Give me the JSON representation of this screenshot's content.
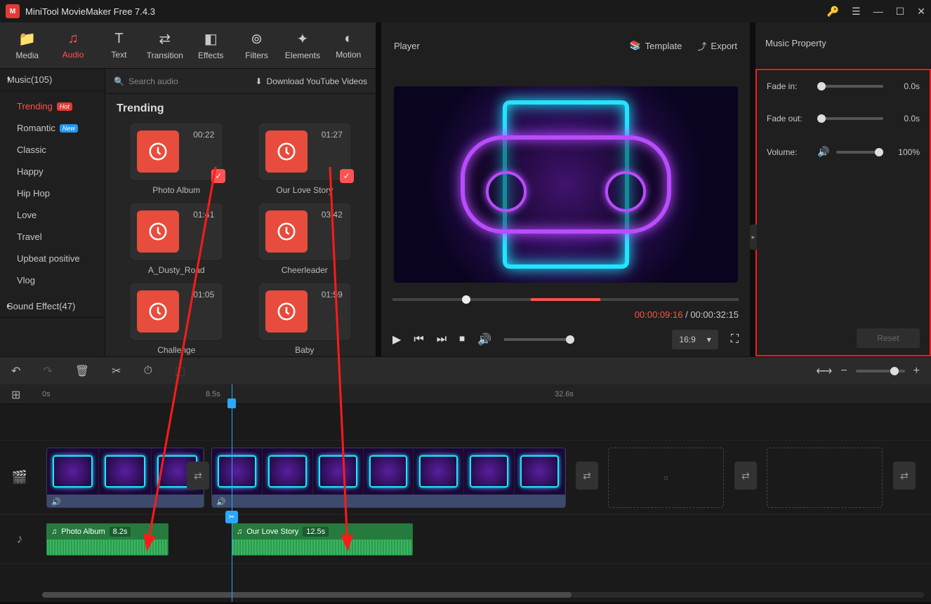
{
  "app": {
    "title": "MiniTool MovieMaker Free 7.4.3"
  },
  "tabs": {
    "media": "Media",
    "audio": "Audio",
    "text": "Text",
    "transition": "Transition",
    "effects": "Effects",
    "filters": "Filters",
    "elements": "Elements",
    "motion": "Motion"
  },
  "sidebar": {
    "music_header": "Music(105)",
    "categories": [
      "Trending",
      "Romantic",
      "Classic",
      "Happy",
      "Hip Hop",
      "Love",
      "Travel",
      "Upbeat positive",
      "Vlog"
    ],
    "sound_effect": "Sound Effect(47)"
  },
  "mid": {
    "search_placeholder": "Search audio",
    "download_yt": "Download YouTube Videos",
    "title": "Trending",
    "tracks": [
      {
        "dur": "00:22",
        "name": "Photo Album",
        "checked": true
      },
      {
        "dur": "01:27",
        "name": "Our Love Story",
        "checked": true
      },
      {
        "dur": "01:41",
        "name": "A_Dusty_Road",
        "checked": false
      },
      {
        "dur": "03:42",
        "name": "Cheerleader",
        "checked": false
      },
      {
        "dur": "01:05",
        "name": "Challenge",
        "checked": false
      },
      {
        "dur": "01:59",
        "name": "Baby",
        "checked": false
      }
    ]
  },
  "player": {
    "title": "Player",
    "template": "Template",
    "export": "Export",
    "current": "00:00:09:16",
    "total": "00:00:32:15",
    "aspect": "16:9"
  },
  "props": {
    "title": "Music Property",
    "fade_in_label": "Fade in:",
    "fade_in_val": "0.0s",
    "fade_out_label": "Fade out:",
    "fade_out_val": "0.0s",
    "volume_label": "Volume:",
    "volume_val": "100%",
    "reset": "Reset"
  },
  "timeline": {
    "marks": {
      "m0": "0s",
      "m1": "8.5s",
      "m2": "32.6s"
    },
    "clip1": {
      "name": "Photo Album",
      "dur": "8.2s"
    },
    "clip2": {
      "name": "Our Love Story",
      "dur": "12.5s"
    }
  }
}
